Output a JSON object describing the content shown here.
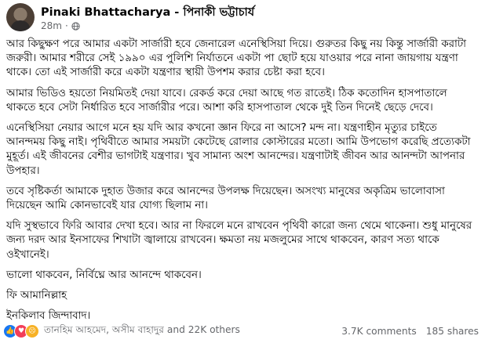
{
  "post": {
    "author": "Pinaki Bhattacharya - পিনাকী ভট্টাচার্য",
    "time": "28m",
    "separator": "·",
    "privacy_icon": "globe-icon",
    "paragraphs": [
      "আর কিছুক্ষণ পরে আমার একটা সার্জারী হবে জেনারেল এনেস্থিসিয়া দিয়ে। গুরুতর কিছু নয় কিন্তু সার্জারী করাটা জরুরী। আমার শরীরে সেই ১৯৯০ এর পুলিশি নির্যাতনে একটা পা ছোট হয়ে যাওয়ার পরে নানা জায়গায় যন্ত্রণা থাকে। তো এই সার্জারী করে একটা যন্ত্রণার স্থায়ী উপশম করার চেষ্টা করা হবে।",
      "আমার ভিডিও হয়তো নিয়মিতই দেয়া যাবে। রেকর্ড করে দেয়া আছে গত রাতেই। ঠিক কতোদিন হাসপাতালে থাকতে হবে সেটা নির্ধারিত হবে সার্জারীর পরে। আশা করি হাসপাতাল থেকে দুই তিন দিনেই ছেড়ে দেবে।",
      "এনেস্থিসিয়া নেয়ার আগে মনে হয় যদি আর কখনো জ্ঞান ফিরে না আসে? মন্দ না। যন্ত্রণাহীন মৃত্যুর চাইতে আনন্দময় কিছু নাই। পৃথিবীতে আমার সময়টা কেটেছে রোলার কোস্টারের মতো। আমি উপভোগ করেছি প্রত্যেকটা মুহূর্ত। এই জীবনের বেশীর ভাগটাই যন্ত্রণার। খুব সামান্য অংশ আনন্দের। যন্ত্রণাটাই জীবন আর আনন্দটা আপনার উপহার।",
      "তবে সৃষ্টিকর্তা আমাকে দুহাত উজার করে আনন্দের উপলক্ষ দিয়েছেন। অসংখ্য মানুষের অকৃত্রিম ভালোবাসা দিয়েছেন আমি কোনভাবেই যার যোগ্য ছিলাম না।",
      "যদি সুস্থভাবে ফিরি আবার দেখা হবে। আর না ফিরলে মনে রাখবেন পৃথিবী কারো জন্য থেমে থাকেনা। শুধু মানুষের জন্য দরদ আর ইনসাফের শিখাটা জ্বালায়ে রাখবেন। ক্ষমতা নয় মজলুমের সাথে থাকবেন, কারণ সত্য থাকে ওইখানেই।",
      "ভালো থাকবেন, নির্বিঘ্নে আর আনন্দে থাকবেন।",
      "ফি আমানিল্লাহ",
      "ইনকিলাব জিন্দাবাদ।"
    ],
    "reactions": {
      "icons": [
        "like-reaction-icon",
        "love-reaction-icon",
        "sad-reaction-icon"
      ],
      "names": "তানহিম আহমেদ, অসীম বাহাদুর and 22K others",
      "comments": "3.7K comments",
      "shares": "185 shares"
    }
  },
  "colors": {
    "text": "#050505",
    "secondary": "#65676b",
    "like": "#1877f2",
    "love": "#f33e58",
    "sad": "#f7b125"
  }
}
